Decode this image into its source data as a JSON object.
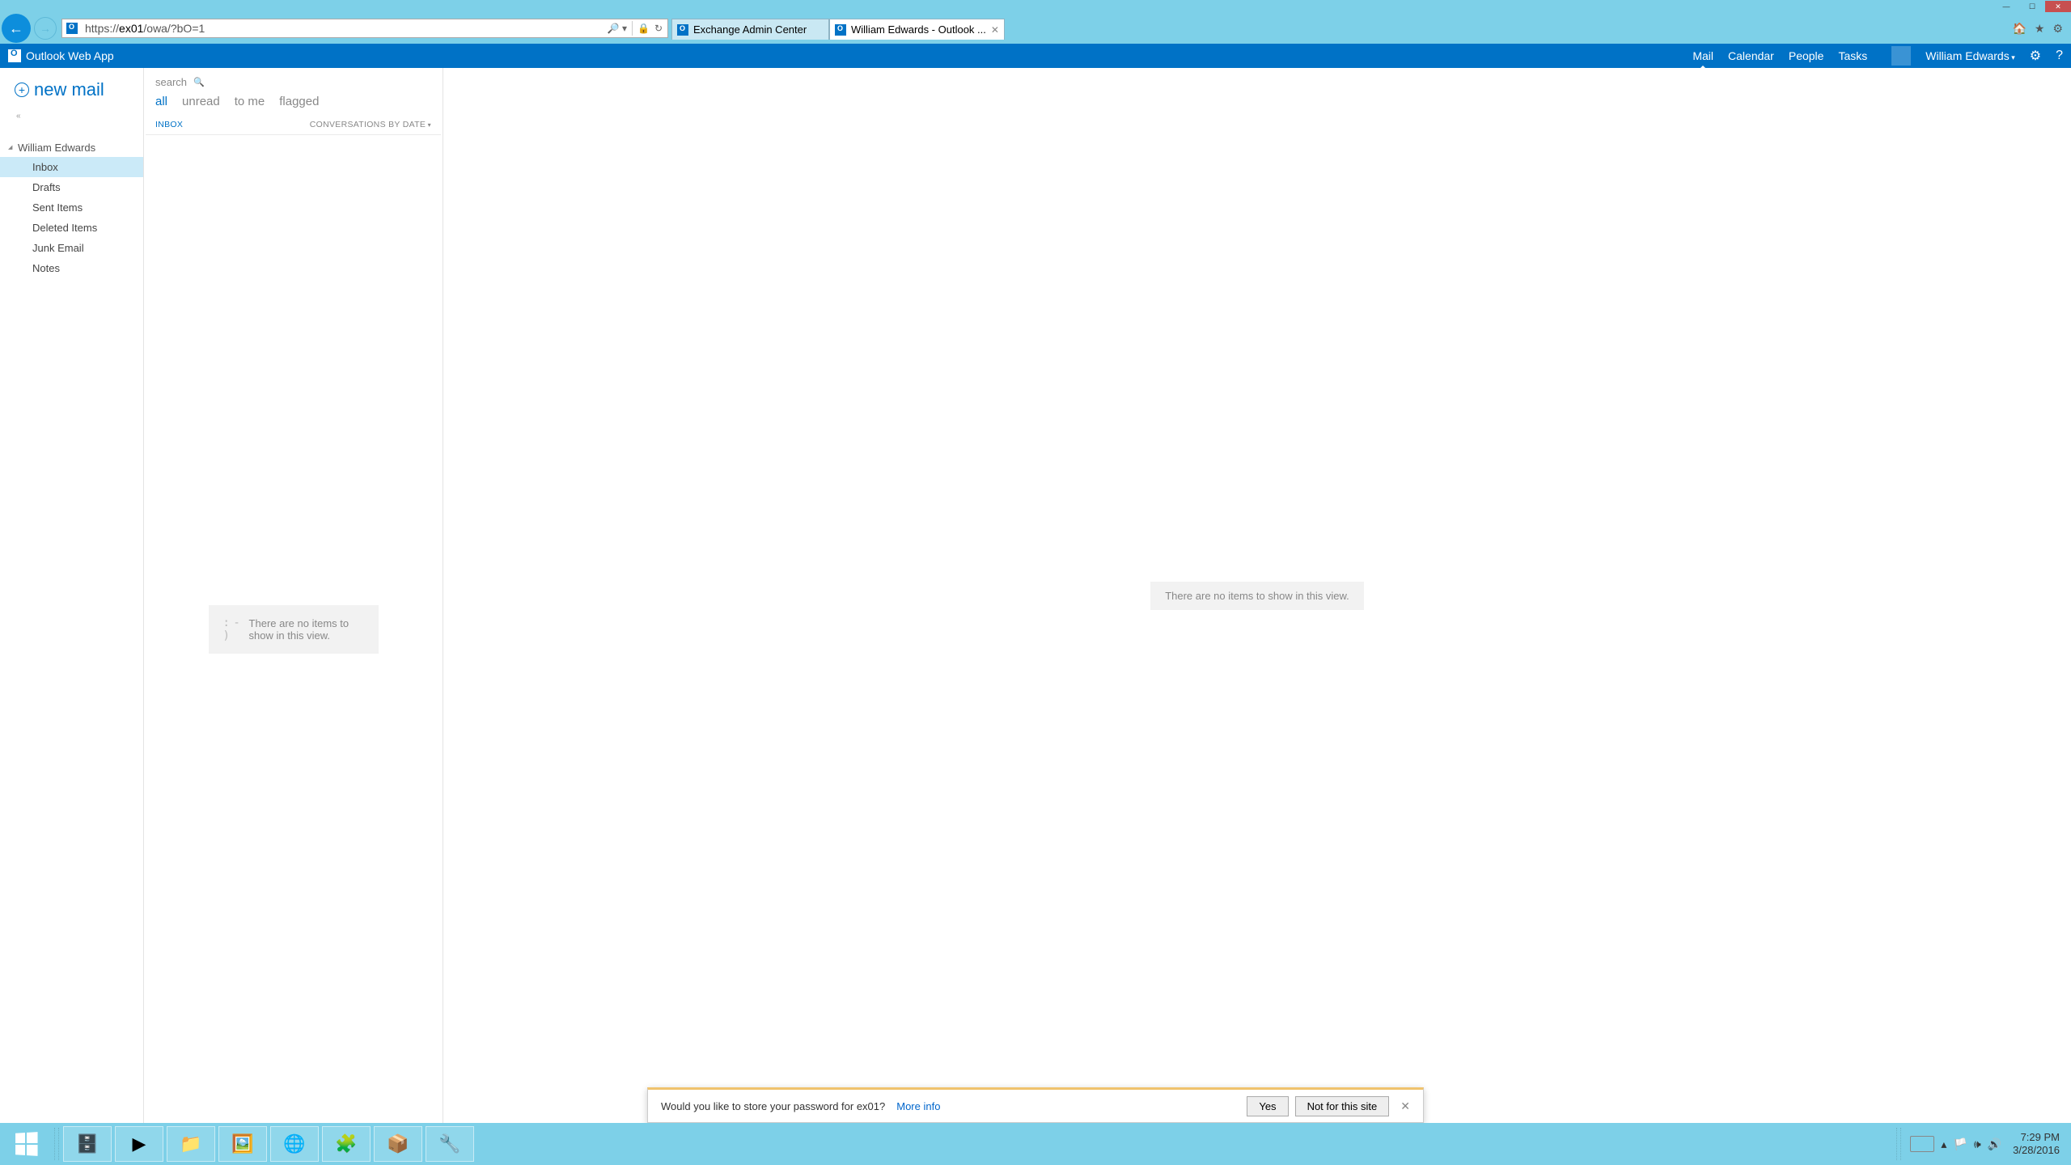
{
  "window": {
    "title": "William Edwards - Outlook ..."
  },
  "browser": {
    "url_prefix": "https://",
    "url_host": "ex01",
    "url_path": "/owa/?bO=1",
    "tabs": [
      {
        "label": "Exchange Admin Center",
        "active": false
      },
      {
        "label": "William Edwards - Outlook ...",
        "active": true
      }
    ]
  },
  "owa": {
    "app_name": "Outlook Web App",
    "nav": {
      "mail": "Mail",
      "calendar": "Calendar",
      "people": "People",
      "tasks": "Tasks"
    },
    "user": "William Edwards",
    "new_mail": "new mail",
    "collapse": "«",
    "account": "William Edwards",
    "folders": {
      "inbox": "Inbox",
      "drafts": "Drafts",
      "sent": "Sent Items",
      "deleted": "Deleted Items",
      "junk": "Junk Email",
      "notes": "Notes"
    },
    "search_placeholder": "search",
    "filters": {
      "all": "all",
      "unread": "unread",
      "tome": "to me",
      "flagged": "flagged"
    },
    "list_header_left": "INBOX",
    "list_header_sort": "CONVERSATIONS BY DATE",
    "empty_face": ": - )",
    "empty_list_msg": "There are no items to show in this view.",
    "empty_read_msg": "There are no items to show in this view."
  },
  "pwbar": {
    "msg": "Would you like to store your password for ex01?",
    "more": "More info",
    "yes": "Yes",
    "no": "Not for this site"
  },
  "taskbar": {
    "time": "7:29 PM",
    "date": "3/28/2016"
  }
}
